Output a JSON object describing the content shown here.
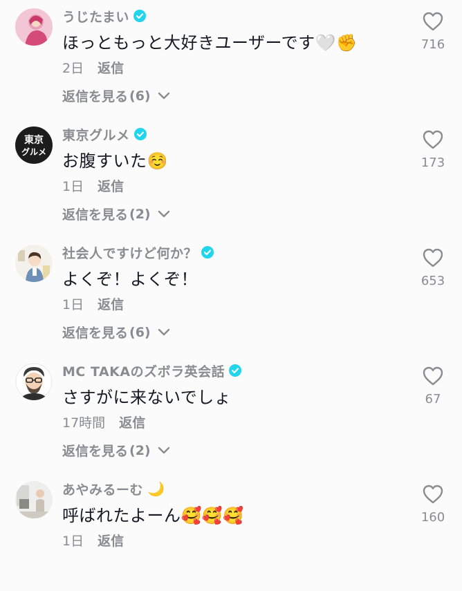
{
  "comments": [
    {
      "author": "うじたまい",
      "verified": true,
      "author_emoji": "",
      "text": "ほっともっと大好きユーザーです🤍✊",
      "time": "2日",
      "reply_label": "返信",
      "view_replies_label": "返信を見る",
      "reply_count": "(6)",
      "likes": "716",
      "avatar": "pink-portrait"
    },
    {
      "author": "東京グルメ",
      "verified": true,
      "author_emoji": "",
      "text": "お腹すいた☺️",
      "time": "1日",
      "reply_label": "返信",
      "view_replies_label": "返信を見る",
      "reply_count": "(2)",
      "likes": "173",
      "avatar": "text-logo",
      "avatar_text_line1": "東京",
      "avatar_text_line2": "グルメ"
    },
    {
      "author": "社会人ですけど何か？",
      "verified": true,
      "author_emoji": "",
      "text": "よくぞ！よくぞ！",
      "time": "1日",
      "reply_label": "返信",
      "view_replies_label": "返信を見る",
      "reply_count": "(6)",
      "likes": "653",
      "avatar": "illustrated-office-worker"
    },
    {
      "author": "MC TAKAのズボラ英会話",
      "verified": true,
      "author_emoji": "",
      "text": "さすがに来ないでしょ",
      "time": "17時間",
      "reply_label": "返信",
      "view_replies_label": "返信を見る",
      "reply_count": "(2)",
      "likes": "67",
      "avatar": "bearded-man-glasses"
    },
    {
      "author": "あやみるーむ",
      "verified": false,
      "author_emoji": "🌙",
      "text": "呼ばれたよーん🥰🥰🥰",
      "time": "1日",
      "reply_label": "返信",
      "view_replies_label": "",
      "reply_count": "",
      "likes": "160",
      "avatar": "room-photo"
    }
  ],
  "colors": {
    "background": "#fbfbfb",
    "text_primary": "#161823",
    "text_secondary": "#8a8b91",
    "verified_badge": "#20d5ec"
  },
  "icons": {
    "like": "heart-outline-icon",
    "verified": "verified-badge-icon",
    "expand": "chevron-down-icon"
  }
}
